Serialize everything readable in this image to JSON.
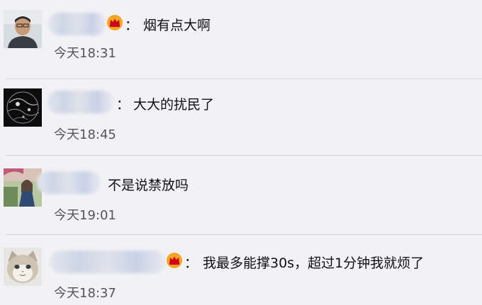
{
  "comments": [
    {
      "has_vip": true,
      "separator": "：",
      "text": "烟有点大啊",
      "time": "今天18:31"
    },
    {
      "has_vip": false,
      "separator": "：",
      "text": "大大的扰民了",
      "time": "今天18:45"
    },
    {
      "has_vip": false,
      "separator": "",
      "text": "不是说禁放吗",
      "time": "今天19:01"
    },
    {
      "has_vip": true,
      "separator": "：",
      "text": "我最多能撑30s，超过1分钟我就烦了",
      "time": "今天18:37"
    }
  ],
  "icons": {
    "vip": "vip-crown-icon"
  },
  "colors": {
    "background": "#f2f2f6",
    "divider": "#cfcfd4",
    "timestamp": "#555555",
    "vip": "#f5a623"
  }
}
